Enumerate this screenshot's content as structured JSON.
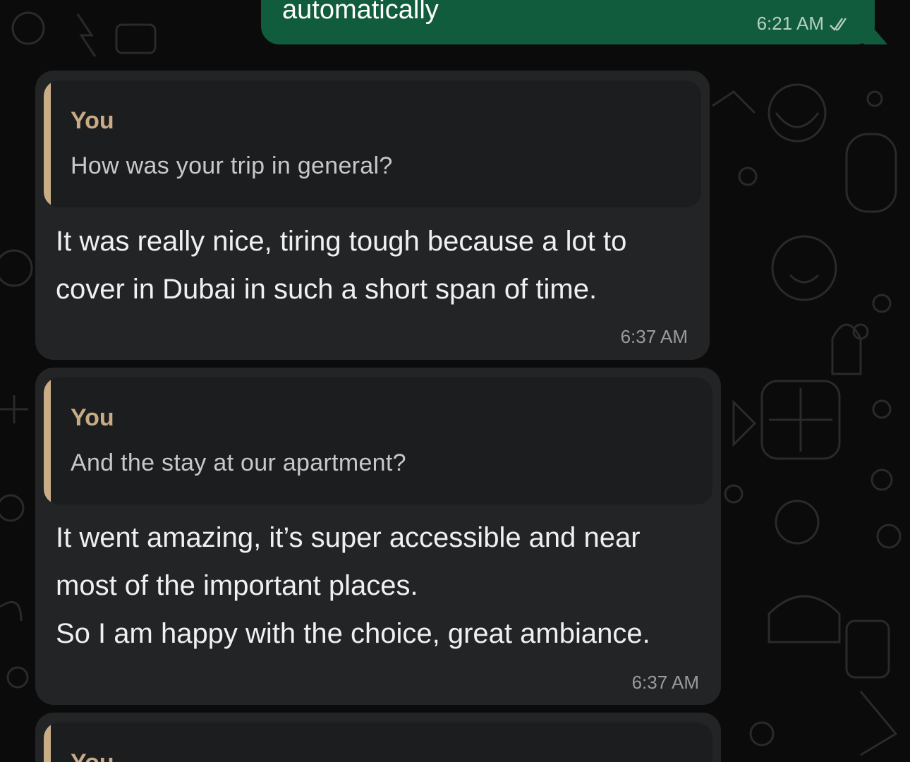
{
  "sent_message": {
    "text": "automatically",
    "time": "6:21 AM",
    "status_icon": "double-check-icon"
  },
  "messages": [
    {
      "quote_author": "You",
      "quote_text": "How was your trip in general?",
      "lines": [
        "It was really nice, tiring tough because a lot to",
        "cover in Dubai in such a short span of time."
      ],
      "time": "6:37 AM"
    },
    {
      "quote_author": "You",
      "quote_text": "And the stay at our apartment?",
      "lines": [
        "It went amazing, it’s super accessible and near",
        "most of the important places.",
        "So I am happy with the choice, great ambiance."
      ],
      "time": "6:37 AM"
    },
    {
      "quote_author": "You"
    }
  ],
  "colors": {
    "background": "#0b0b0b",
    "outgoing_bubble": "#125c3e",
    "incoming_bubble": "#232426",
    "quote_bubble": "#1c1d1f",
    "quote_accent": "#c9ad86"
  }
}
